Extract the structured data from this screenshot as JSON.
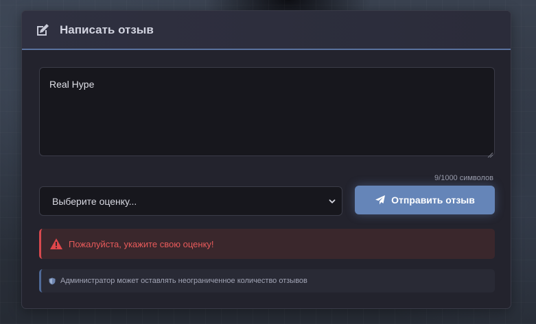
{
  "colors": {
    "card_bg": "#23232d",
    "header_accent": "#5a73a0",
    "button_bg": "#6585b8",
    "error_text": "#e85a5a",
    "error_border": "#d9494e",
    "info_border": "#4f6a98"
  },
  "header": {
    "icon": "edit-icon",
    "title": "Написать отзыв"
  },
  "review": {
    "value": "Real Hype",
    "char_count": "9/1000",
    "char_label": "символов"
  },
  "rating": {
    "selected": "Выберите оценку...",
    "icon": "chevron-down-icon"
  },
  "submit": {
    "icon": "paper-plane-icon",
    "label": "Отправить отзыв"
  },
  "error": {
    "icon": "warning-icon",
    "text": "Пожалуйста, укажите свою оценку!"
  },
  "info": {
    "icon": "shield-icon",
    "text": "Администратор может оставлять неограниченное количество отзывов"
  }
}
